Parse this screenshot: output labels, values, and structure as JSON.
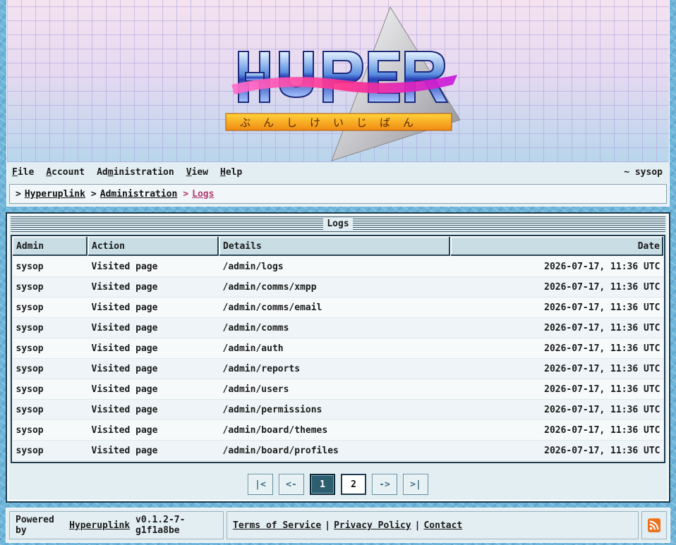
{
  "menu": {
    "items": [
      {
        "key": "F",
        "rest": "ile"
      },
      {
        "key": "A",
        "rest": "ccount"
      },
      {
        "pre": "Ad",
        "key": "m",
        "rest": "inistration"
      },
      {
        "key": "V",
        "rest": "iew"
      },
      {
        "key": "H",
        "rest": "elp"
      }
    ],
    "user": "~ sysop"
  },
  "breadcrumb": {
    "items": [
      "Hyperuplink",
      "Administration",
      "Logs"
    ]
  },
  "panel": {
    "title": "Logs"
  },
  "table": {
    "columns": [
      "Admin",
      "Action",
      "Details",
      "Date"
    ],
    "rows": [
      [
        "sysop",
        "Visited page",
        "/admin/logs",
        "2026-07-17, 11:36 UTC"
      ],
      [
        "sysop",
        "Visited page",
        "/admin/comms/xmpp",
        "2026-07-17, 11:36 UTC"
      ],
      [
        "sysop",
        "Visited page",
        "/admin/comms/email",
        "2026-07-17, 11:36 UTC"
      ],
      [
        "sysop",
        "Visited page",
        "/admin/comms",
        "2026-07-17, 11:36 UTC"
      ],
      [
        "sysop",
        "Visited page",
        "/admin/auth",
        "2026-07-17, 11:36 UTC"
      ],
      [
        "sysop",
        "Visited page",
        "/admin/reports",
        "2026-07-17, 11:36 UTC"
      ],
      [
        "sysop",
        "Visited page",
        "/admin/users",
        "2026-07-17, 11:36 UTC"
      ],
      [
        "sysop",
        "Visited page",
        "/admin/permissions",
        "2026-07-17, 11:36 UTC"
      ],
      [
        "sysop",
        "Visited page",
        "/admin/board/themes",
        "2026-07-17, 11:36 UTC"
      ],
      [
        "sysop",
        "Visited page",
        "/admin/board/profiles",
        "2026-07-17, 11:36 UTC"
      ]
    ]
  },
  "pagination": {
    "first": "|<",
    "prev": "<-",
    "pages": [
      "1",
      "2"
    ],
    "current_page": "1",
    "next": "->",
    "last": ">|"
  },
  "footer": {
    "powered_prefix": "Powered by",
    "app_name": "Hyperuplink",
    "version": "v0.1.2-7-g1f1a8be",
    "links": [
      "Terms of Service",
      "Privacy Policy",
      "Contact"
    ]
  },
  "icons": {
    "rss": "rss-feed-icon"
  },
  "colors": {
    "accent": "#2c5e70",
    "breadcrumb_current": "#b23a6e",
    "rss": "#e2621b"
  }
}
